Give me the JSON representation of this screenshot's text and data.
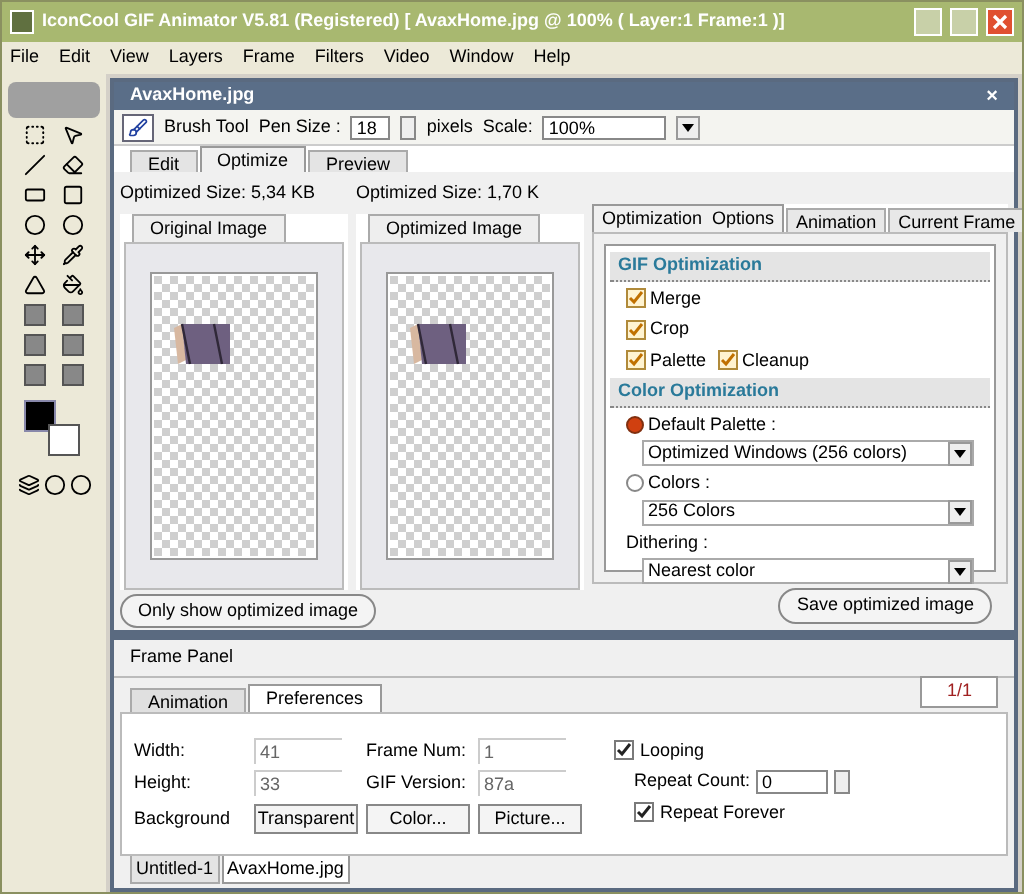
{
  "window": {
    "title": "IconCool GIF Animator V5.81 (Registered) [ AvaxHome.jpg @ 100% ( Layer:1 Frame:1 )]"
  },
  "menu": [
    "File",
    "Edit",
    "View",
    "Layers",
    "Frame",
    "Filters",
    "Video",
    "Window",
    "Help"
  ],
  "document": {
    "title": "AvaxHome.jpg",
    "close": "×"
  },
  "toolbar": {
    "tool": "Brush Tool",
    "pen_size_label": "Pen Size :",
    "pen_size": "18",
    "pen_unit": "pixels",
    "scale_label": "Scale:",
    "scale": "100%"
  },
  "tabs": [
    {
      "label": "Edit",
      "selected": false
    },
    {
      "label": "Optimize",
      "selected": true
    },
    {
      "label": "Preview",
      "selected": false
    }
  ],
  "panes": [
    {
      "size": "Optimized Size: 5,34 KB",
      "tab": "Original Image"
    },
    {
      "size": "Optimized Size: 1,70 K",
      "tab": "Optimized Image"
    }
  ],
  "options_tabs": [
    {
      "label": "Optimization  Options",
      "selected": true
    },
    {
      "label": "Animation",
      "selected": false
    },
    {
      "label": "Current Frame",
      "selected": false
    }
  ],
  "gif_optimization": {
    "heading": "GIF Optimization",
    "checks": [
      {
        "label": "Merge",
        "checked": true
      },
      {
        "label": "Crop",
        "checked": true
      },
      {
        "label": "Palette",
        "checked": true
      },
      {
        "label": "Cleanup",
        "checked": true
      }
    ]
  },
  "color_optimization": {
    "heading": "Color Optimization",
    "options": [
      {
        "label": "Default Palette :",
        "selected": true,
        "value": "Optimized Windows (256 colors)"
      },
      {
        "label": "Colors :",
        "selected": false,
        "value": "256 Colors"
      }
    ],
    "dithering_label": "Dithering :",
    "dithering": "Nearest color"
  },
  "buttons": {
    "left": "Only show optimized image",
    "right": "Save optimized image"
  },
  "frame_panel": {
    "title": "Frame Panel",
    "tabs": [
      {
        "label": "Animation",
        "selected": false
      },
      {
        "label": "Preferences",
        "selected": true
      }
    ],
    "counter": "1/1",
    "fields": [
      {
        "label": "Width:",
        "value": "41"
      },
      {
        "label": "Frame Num:",
        "value": "1"
      },
      {
        "label": "Height:",
        "value": "33"
      },
      {
        "label": "GIF Version:",
        "value": "87a"
      }
    ],
    "looping": {
      "label": "Looping",
      "checked": true
    },
    "repeat_count_label": "Repeat Count:",
    "repeat_count": "0",
    "repeat_forever": {
      "label": "Repeat Forever",
      "checked": true
    },
    "background_label": "Background",
    "background_buttons": [
      "Transparent",
      "Color...",
      "Picture..."
    ]
  },
  "doc_tabs": [
    {
      "label": "Untitled-1",
      "selected": false
    },
    {
      "label": "AvaxHome.jpg",
      "selected": true
    }
  ]
}
